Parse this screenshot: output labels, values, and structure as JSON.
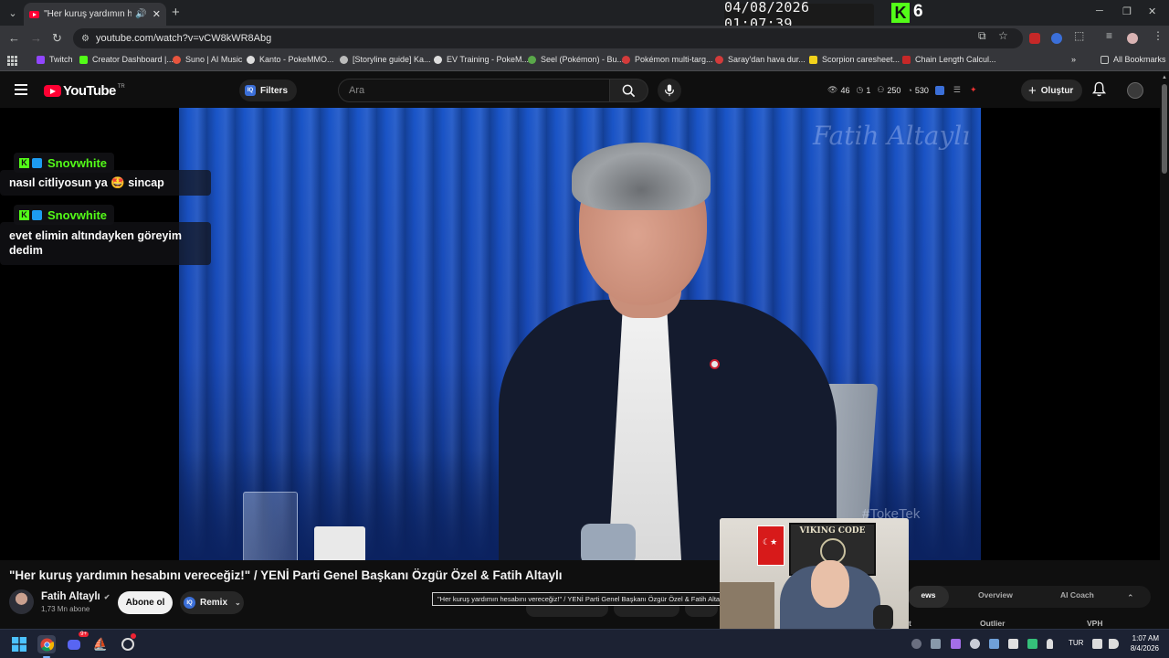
{
  "overlay": {
    "clock": "04/08/2026 01:07:39",
    "viewer_count": "6"
  },
  "browser": {
    "tab_title": "\"Her kuruş yardımın hesabı",
    "url": "youtube.com/watch?v=vCW8kWR8Abg",
    "bookmarks": [
      {
        "label": "Twitch",
        "color": "#9146ff"
      },
      {
        "label": "Creator Dashboard |...",
        "color": "#53fc18"
      },
      {
        "label": "Suno | AI Music",
        "color": "#e8553e"
      },
      {
        "label": "Kanto - PokeMMO...",
        "color": "#dddddd"
      },
      {
        "label": "[Storyline guide] Ka...",
        "color": "#bbbbbb"
      },
      {
        "label": "EV Training - PokeM...",
        "color": "#dddddd"
      },
      {
        "label": "Seel (Pokémon) - Bu...",
        "color": "#5aa84a"
      },
      {
        "label": "Pokémon multi-targ...",
        "color": "#d33b3b"
      },
      {
        "label": "Saray'dan hava dur...",
        "color": "#d33b3b"
      },
      {
        "label": "Scorpion caresheet...",
        "color": "#f2d21b"
      },
      {
        "label": "Chain Length Calcul...",
        "color": "#c62828"
      }
    ],
    "more_bookmarks": "»",
    "all_bookmarks": "All Bookmarks"
  },
  "youtube": {
    "logo_text": "YouTube",
    "region": "TR",
    "filters_label": "Filters",
    "search_placeholder": "Ara",
    "stats": {
      "views": "46",
      "time": "1",
      "users": "250",
      "subs": "530"
    },
    "create_label": "Oluştur"
  },
  "chat": [
    {
      "user": "Snovwhite",
      "text": "nasıl citliyosun ya 🤩 sincap"
    },
    {
      "user": "Snovwhite",
      "text": "evet elimin altındayken göreyim dedim"
    }
  ],
  "video": {
    "watermark": "Fatih Altaylı",
    "corner_tag": "#TokeTek",
    "title": "\"Her kuruş yardımın hesabını vereceğiz!\" / YENİ Parti Genel Başkanı Özgür Özel & Fatih Altaylı",
    "tooltip": "\"Her kuruş yardımın hesabını vereceğiz!\" / YENİ Parti Genel Başkanı Özgür Özel & Fatih Altaylı"
  },
  "channel": {
    "name": "Fatih Altaylı",
    "subscribers": "1,73 Mn abone",
    "subscribe_label": "Abone ol",
    "remix_label": "Remix"
  },
  "panel": {
    "tabs": [
      "ews",
      "Overview",
      "AI Coach"
    ],
    "active_tab": "ews",
    "sub_headers": [
      "t",
      "Outlier",
      "VPH"
    ]
  },
  "webcam": {
    "poster_text": "VIKING CODE"
  },
  "taskbar": {
    "language": "TUR",
    "time": "1:07 AM",
    "date": "8/4/2026",
    "discord_badge": "9+"
  }
}
